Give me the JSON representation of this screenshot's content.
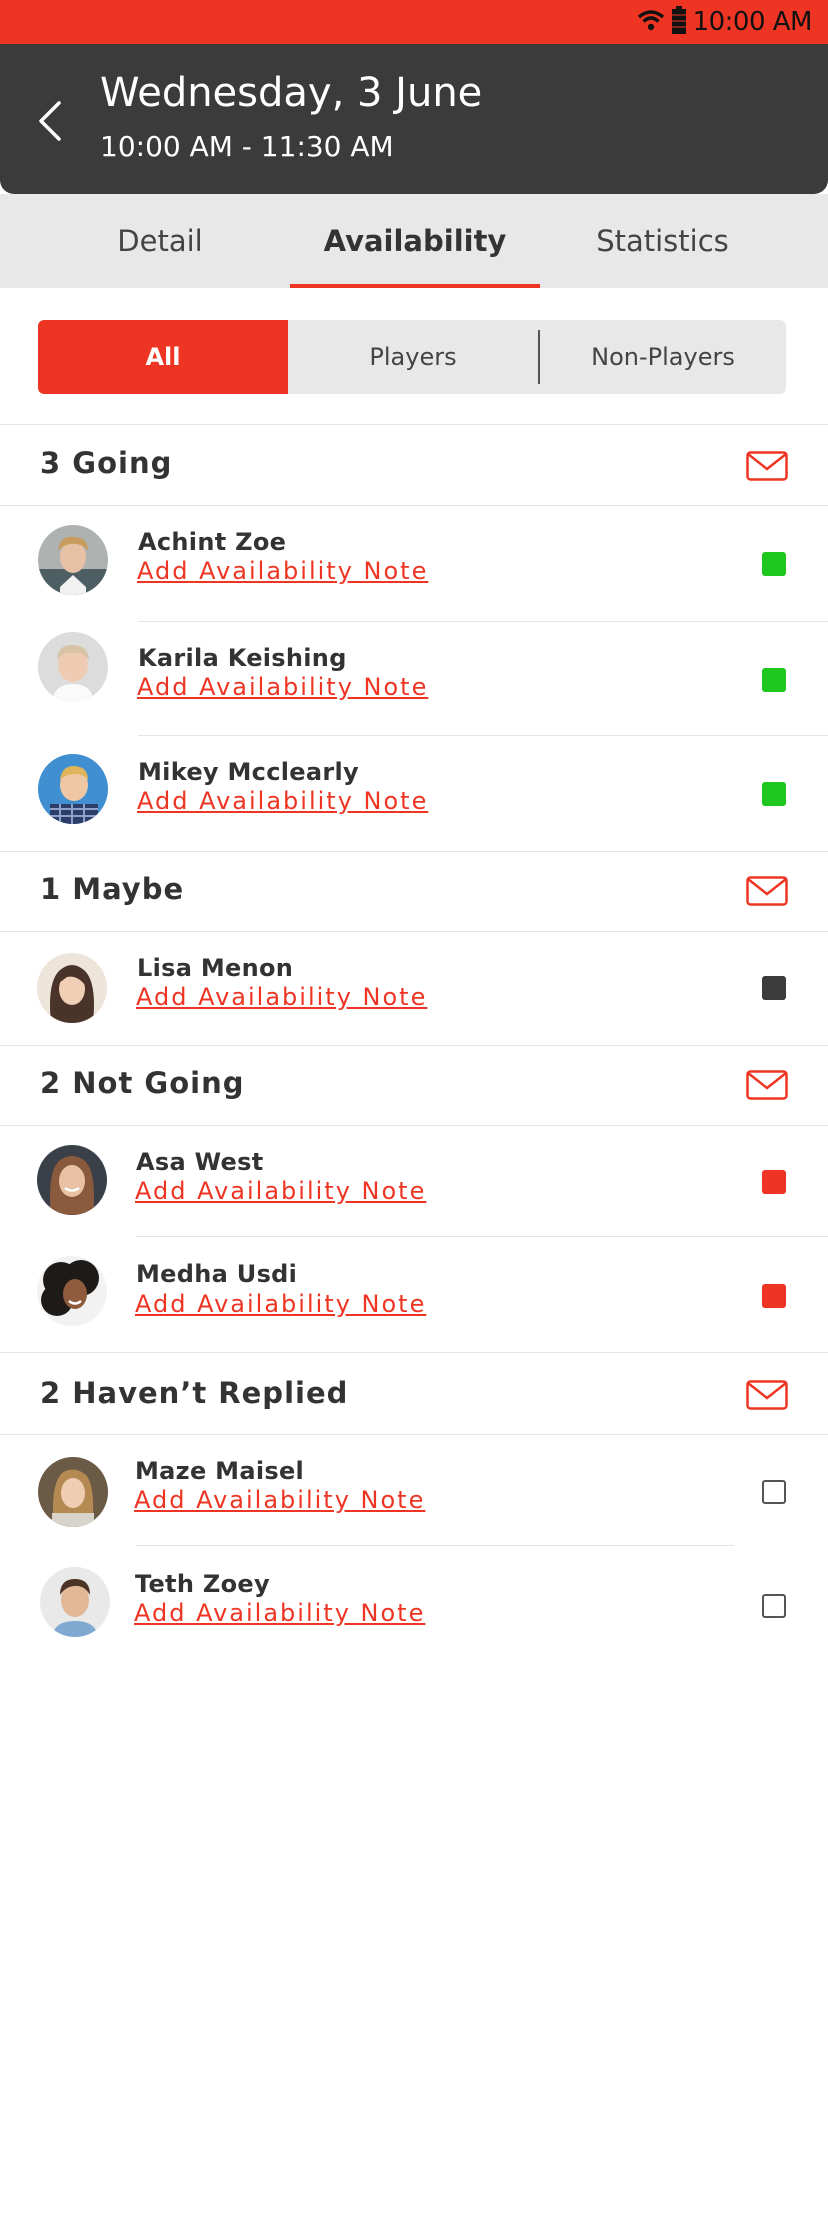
{
  "status_bar": {
    "time": "10:00 AM"
  },
  "header": {
    "title": "Wednesday, 3 June",
    "time_range": "10:00 AM - 11:30 AM"
  },
  "tabs": [
    {
      "label": "Detail"
    },
    {
      "label": "Availability"
    },
    {
      "label": "Statistics"
    }
  ],
  "filter": {
    "all": "All",
    "players": "Players",
    "non_players": "Non-Players"
  },
  "sections": [
    {
      "title": "3 Going",
      "people": [
        {
          "name": "Achint Zoe",
          "note": "Add Availability Note",
          "status": "going"
        },
        {
          "name": "Karila Keishing",
          "note": "Add Availability Note",
          "status": "going"
        },
        {
          "name": "Mikey Mcclearly",
          "note": "Add Availability Note",
          "status": "going"
        }
      ]
    },
    {
      "title": "1 Maybe",
      "people": [
        {
          "name": "Lisa Menon",
          "note": "Add Availability Note",
          "status": "maybe"
        }
      ]
    },
    {
      "title": "2 Not Going",
      "people": [
        {
          "name": "Asa West",
          "note": "Add Availability Note",
          "status": "not_going"
        },
        {
          "name": "Medha Usdi",
          "note": "Add Availability Note",
          "status": "not_going"
        }
      ]
    },
    {
      "title": "2 Haven’t Replied",
      "people": [
        {
          "name": "Maze Maisel",
          "note": "Add Availability Note",
          "status": "no_reply"
        },
        {
          "name": "Teth Zoey",
          "note": "Add Availability Note",
          "status": "no_reply"
        }
      ]
    }
  ],
  "colors": {
    "accent": "#ee3524",
    "header_bg": "#3b3b3b",
    "going": "#1ec71e",
    "maybe": "#3b3b3b",
    "not_going": "#ee3524"
  }
}
